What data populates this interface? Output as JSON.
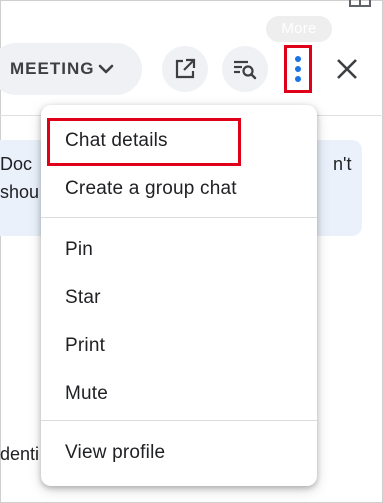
{
  "header": {
    "tooltip": "More",
    "meeting_label": "MEETING"
  },
  "background": {
    "line1_left": "Doc",
    "line2_left": "shou",
    "line1_right": "n't",
    "line3_left": "denti"
  },
  "menu": {
    "items": [
      {
        "label": "Chat details"
      },
      {
        "label": "Create a group chat"
      },
      {
        "label": "Pin"
      },
      {
        "label": "Star"
      },
      {
        "label": "Print"
      },
      {
        "label": "Mute"
      },
      {
        "label": "View profile"
      }
    ]
  },
  "colors": {
    "highlight": "#e0001a",
    "accent_blue": "#1a73e8",
    "pill_bg": "#eff1f4",
    "message_bg": "#eaf1fb"
  },
  "icons": [
    "open-in-new-icon",
    "search-in-chat-icon",
    "more-vert-icon",
    "close-icon",
    "chevron-down-icon"
  ]
}
